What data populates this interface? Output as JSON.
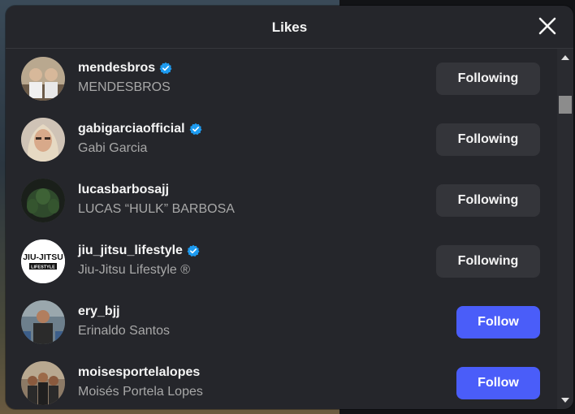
{
  "dialog": {
    "title": "Likes"
  },
  "users": [
    {
      "username": "mendesbros",
      "full_name": "MENDESBROS",
      "verified": true,
      "button": "Following",
      "state": "following"
    },
    {
      "username": "gabigarciaofficial",
      "full_name": "Gabi Garcia",
      "verified": true,
      "button": "Following",
      "state": "following"
    },
    {
      "username": "lucasbarbosajj",
      "full_name": "LUCAS “HULK” BARBOSA",
      "verified": false,
      "button": "Following",
      "state": "following"
    },
    {
      "username": "jiu_jitsu_lifestyle",
      "full_name": "Jiu-Jitsu Lifestyle ®",
      "verified": true,
      "button": "Following",
      "state": "following",
      "avatar_text_top": "JIU-JITSU",
      "avatar_text_bottom": "LIFESTYLE"
    },
    {
      "username": "ery_bjj",
      "full_name": "Erinaldo Santos",
      "verified": false,
      "button": "Follow",
      "state": "follow"
    },
    {
      "username": "moisesportelalopes",
      "full_name": "Moisés Portela Lopes",
      "verified": false,
      "button": "Follow",
      "state": "follow"
    }
  ],
  "colors": {
    "follow_button": "#4a5df9",
    "following_button": "#34353a",
    "verified_badge": "#1d9bf0",
    "modal_bg": "#25262b"
  }
}
